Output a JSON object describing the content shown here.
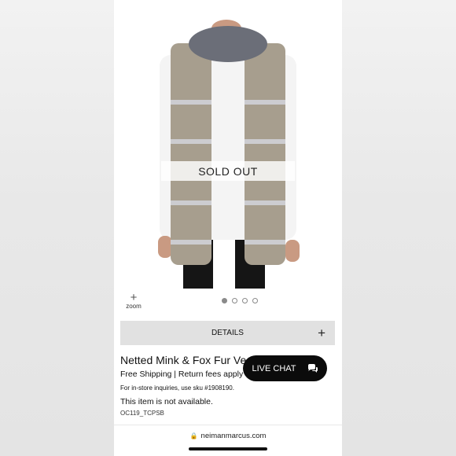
{
  "product": {
    "sold_out_label": "SOLD OUT",
    "zoom_label": "zoom",
    "zoom_symbol": "+",
    "carousel": {
      "count": 4,
      "active_index": 0
    },
    "details_label": "DETAILS",
    "details_symbol": "+",
    "title": "Netted Mink & Fox Fur Ve",
    "shipping": "Free Shipping | Return fees apply",
    "sku_note": "For in-store inquiries, use sku #1908190.",
    "availability": "This item is not available.",
    "item_code": "OC119_TCPSB"
  },
  "chat": {
    "label": "LIVE CHAT",
    "icon": "chat-bubbles-icon"
  },
  "browser": {
    "url": "neimanmarcus.com",
    "lock_icon": "lock-icon"
  },
  "colors": {
    "chat_bg": "#0b0b0b",
    "details_bg": "#e1e1e1",
    "page_bg": "#ffffff"
  }
}
